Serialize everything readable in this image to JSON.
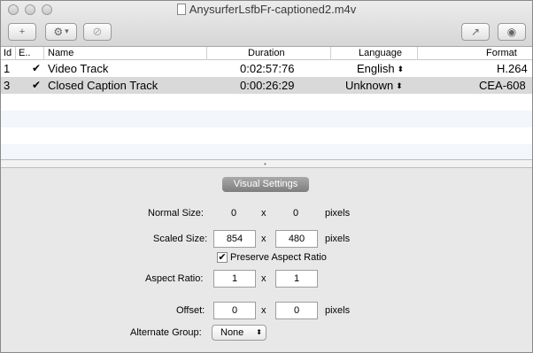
{
  "window": {
    "title": "AnysurferLsfbFr-captioned2.m4v"
  },
  "toolbar": {
    "add_icon_glyph": "+",
    "gear_icon_glyph": "⚙",
    "gear_menu_arrow": "▾",
    "disabled_icon_glyph": "⊘",
    "share_icon_glyph": "↗",
    "inspect_icon_glyph": "◉"
  },
  "table": {
    "headers": {
      "id": "Id",
      "enabled": "E..",
      "name": "Name",
      "duration": "Duration",
      "language": "Language",
      "format": "Format"
    },
    "rows": [
      {
        "id": "1",
        "enabled": "✔",
        "name": "Video Track",
        "duration": "0:02:57:76",
        "language": "English",
        "format": "H.264"
      },
      {
        "id": "3",
        "enabled": "✔",
        "name": "Closed Caption Track",
        "duration": "0:00:26:29",
        "language": "Unknown",
        "format": "CEA-608"
      }
    ],
    "stepper_glyph": "⬍"
  },
  "splitter": {
    "grip_glyph": "•"
  },
  "settings": {
    "section_title": "Visual Settings",
    "normal_size": {
      "label": "Normal Size:",
      "width": "0",
      "times": "x",
      "height": "0",
      "unit": "pixels"
    },
    "scaled_size": {
      "label": "Scaled Size:",
      "width": "854",
      "times": "x",
      "height": "480",
      "unit": "pixels"
    },
    "preserve_aspect": {
      "label": "Preserve Aspect Ratio",
      "checked_glyph": "✔"
    },
    "aspect_ratio": {
      "label": "Aspect Ratio:",
      "width": "1",
      "times": "x",
      "height": "1"
    },
    "offset": {
      "label": "Offset:",
      "x": "0",
      "times": "x",
      "y": "0",
      "unit": "pixels"
    },
    "alternate_group": {
      "label": "Alternate Group:",
      "value": "None",
      "arrows": "⬍"
    }
  }
}
